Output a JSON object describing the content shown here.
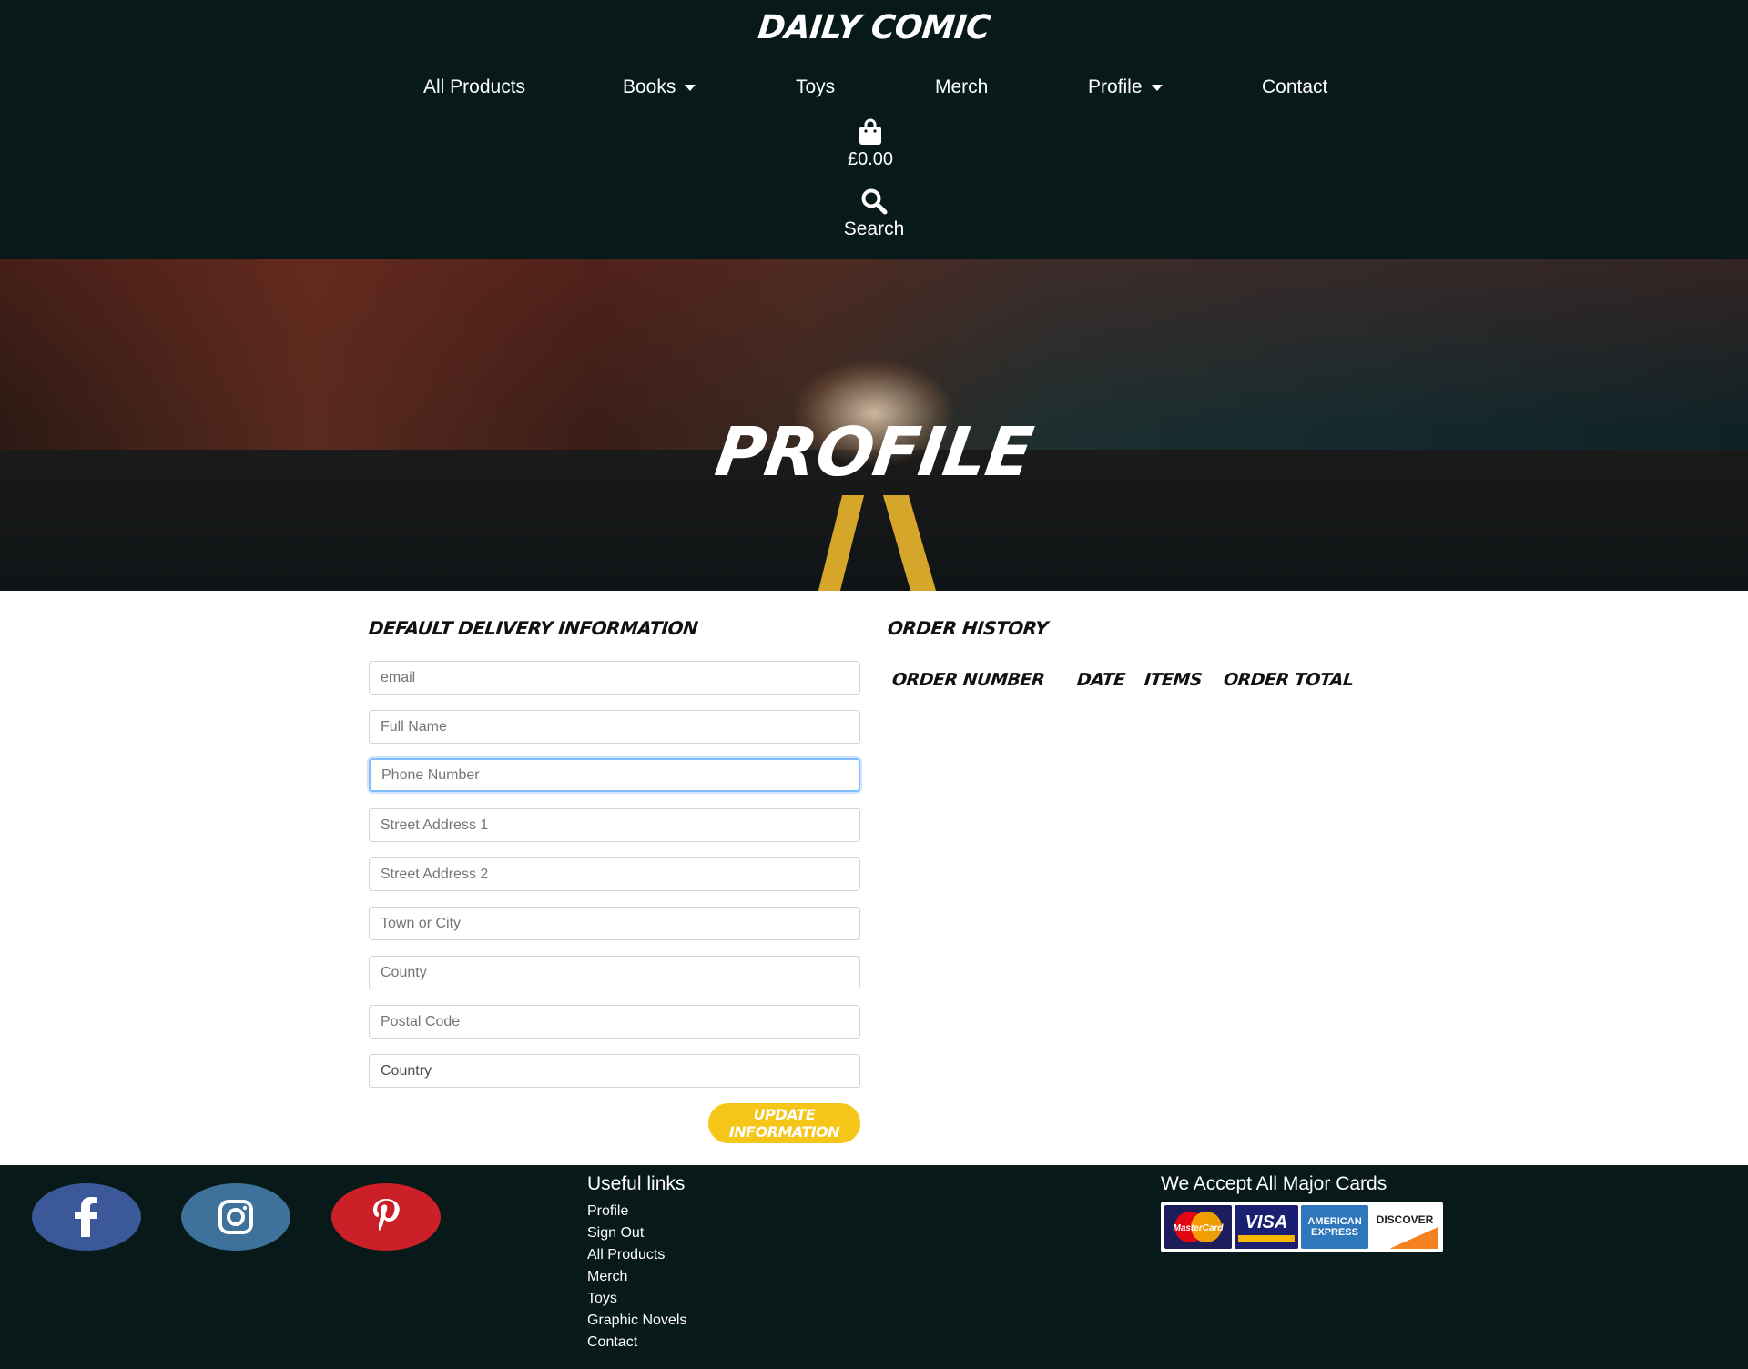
{
  "header": {
    "brand": "DAILY COMIC",
    "nav": [
      {
        "label": "All Products",
        "dropdown": false
      },
      {
        "label": "Books",
        "dropdown": true
      },
      {
        "label": "Toys",
        "dropdown": false
      },
      {
        "label": "Merch",
        "dropdown": false
      },
      {
        "label": "Profile",
        "dropdown": true
      },
      {
        "label": "Contact",
        "dropdown": false
      }
    ],
    "bag_total": "£0.00",
    "search_label": "Search",
    "bag_icon": "shopping-bag-icon",
    "search_icon": "search-icon"
  },
  "hero": {
    "title": "PROFILE"
  },
  "delivery": {
    "title": "DEFAULT DELIVERY INFORMATION",
    "fields": [
      {
        "placeholder": "email",
        "value": ""
      },
      {
        "placeholder": "Full Name",
        "value": ""
      },
      {
        "placeholder": "Phone Number",
        "value": ""
      },
      {
        "placeholder": "Street Address 1",
        "value": ""
      },
      {
        "placeholder": "Street Address 2",
        "value": ""
      },
      {
        "placeholder": "Town or City",
        "value": ""
      },
      {
        "placeholder": "County",
        "value": ""
      },
      {
        "placeholder": "Postal Code",
        "value": ""
      }
    ],
    "country": "Country",
    "update_button": "UPDATE INFORMATION"
  },
  "order_history": {
    "title": "ORDER HISTORY",
    "columns": [
      "ORDER NUMBER",
      "DATE",
      "ITEMS",
      "ORDER TOTAL"
    ]
  },
  "footer": {
    "social": [
      {
        "name": "facebook-icon",
        "color": "#3b5998"
      },
      {
        "name": "instagram-icon",
        "color": "#3f729b"
      },
      {
        "name": "pinterest-icon",
        "color": "#cb2027"
      }
    ],
    "useful_links_title": "Useful links",
    "useful_links": [
      "Profile",
      "Sign Out",
      "All Products",
      "Merch",
      "Toys",
      "Graphic Novels",
      "Contact"
    ],
    "cards_title": "We Accept All Major Cards",
    "cards": [
      "MasterCard",
      "VISA",
      "AMERICAN EXPRESS",
      "DISCOVER"
    ]
  },
  "colors": {
    "header_bg": "#08191a",
    "accent": "#f5c518",
    "focus": "#80bdff"
  }
}
